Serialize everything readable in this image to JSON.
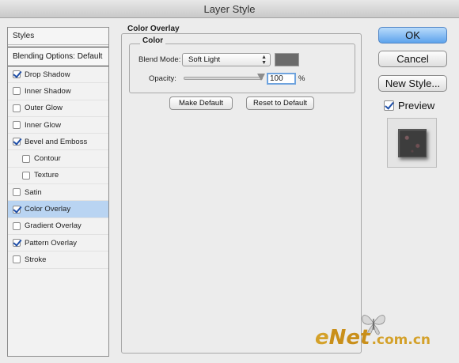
{
  "window": {
    "title": "Layer Style"
  },
  "styles_panel": {
    "header": "Styles",
    "blending_options": "Blending Options: Default",
    "items": [
      {
        "label": "Drop Shadow",
        "checked": true,
        "sub": false,
        "selected": false
      },
      {
        "label": "Inner Shadow",
        "checked": false,
        "sub": false,
        "selected": false
      },
      {
        "label": "Outer Glow",
        "checked": false,
        "sub": false,
        "selected": false
      },
      {
        "label": "Inner Glow",
        "checked": false,
        "sub": false,
        "selected": false
      },
      {
        "label": "Bevel and Emboss",
        "checked": true,
        "sub": false,
        "selected": false
      },
      {
        "label": "Contour",
        "checked": false,
        "sub": true,
        "selected": false
      },
      {
        "label": "Texture",
        "checked": false,
        "sub": true,
        "selected": false
      },
      {
        "label": "Satin",
        "checked": false,
        "sub": false,
        "selected": false
      },
      {
        "label": "Color Overlay",
        "checked": true,
        "sub": false,
        "selected": true
      },
      {
        "label": "Gradient Overlay",
        "checked": false,
        "sub": false,
        "selected": false
      },
      {
        "label": "Pattern Overlay",
        "checked": true,
        "sub": false,
        "selected": false
      },
      {
        "label": "Stroke",
        "checked": false,
        "sub": false,
        "selected": false
      }
    ]
  },
  "color_overlay": {
    "section_title": "Color Overlay",
    "group_title": "Color",
    "blend_mode_label": "Blend Mode:",
    "blend_mode_value": "Soft Light",
    "swatch_color": "#6b6b6b",
    "opacity_label": "Opacity:",
    "opacity_value": "100",
    "opacity_unit": "%",
    "opacity_level": 1.0,
    "make_default": "Make Default",
    "reset_to_default": "Reset to Default"
  },
  "actions": {
    "ok": "OK",
    "cancel": "Cancel",
    "new_style": "New Style...",
    "preview_label": "Preview",
    "preview_checked": true
  },
  "watermark": {
    "e": "e",
    "net": "Net",
    "domain": ".com.cn"
  },
  "colors": {
    "accent": "#5ea3ec",
    "selected_row": "#b9d4f2",
    "watermark": "#d4a12a"
  }
}
